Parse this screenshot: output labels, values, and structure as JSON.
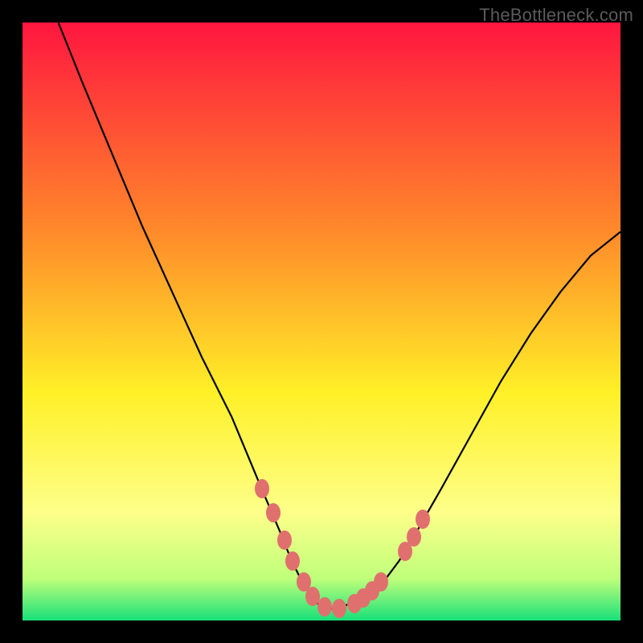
{
  "watermark": "TheBottleneck.com",
  "colors": {
    "frame": "#000000",
    "gradient_top": "#ff163f",
    "gradient_upper_mid": "#ff8a2a",
    "gradient_mid": "#fff028",
    "gradient_lower_mid": "#fdff8a",
    "gradient_near_bottom": "#bfff7a",
    "gradient_bottom": "#18e07a",
    "curve": "#000000",
    "marker": "#e0706e"
  },
  "chart_data": {
    "type": "line",
    "title": "",
    "xlabel": "",
    "ylabel": "",
    "xlim": [
      0,
      100
    ],
    "ylim": [
      0,
      100
    ],
    "grid": false,
    "legend": false,
    "series": [
      {
        "name": "bottleneck-curve",
        "x": [
          6,
          10,
          15,
          20,
          25,
          30,
          35,
          40,
          43,
          45,
          47,
          49,
          51,
          53,
          55,
          57,
          60,
          63,
          66,
          70,
          75,
          80,
          85,
          90,
          95,
          100
        ],
        "values": [
          100,
          90,
          78,
          66,
          55,
          44,
          34,
          22,
          15,
          10,
          6,
          3,
          2,
          2,
          3,
          4,
          6,
          10,
          15,
          22,
          31,
          40,
          48,
          55,
          61,
          65
        ]
      }
    ],
    "markers": {
      "name": "highlight-points",
      "x": [
        40.0,
        42.0,
        43.8,
        45.2,
        47.0,
        48.5,
        50.5,
        53.0,
        55.5,
        57.0,
        58.5,
        60.0,
        64.0,
        65.5,
        67.0
      ],
      "values": [
        22.0,
        18.0,
        13.5,
        10.0,
        6.5,
        4.0,
        2.3,
        2.0,
        2.8,
        3.8,
        5.0,
        6.5,
        11.5,
        14.0,
        17.0
      ]
    }
  }
}
